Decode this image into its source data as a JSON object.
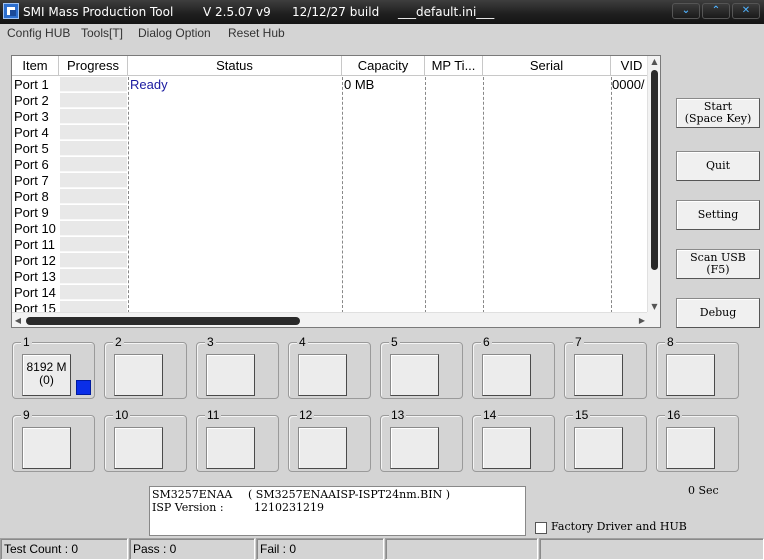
{
  "titlebar": {
    "app_name": "SMI Mass Production Tool",
    "version": "V 2.5.07",
    "v": "v9",
    "build": "12/12/27 build",
    "ini": "___default.ini___",
    "buttons": [
      "chevron-down",
      "chevron-up",
      "close"
    ]
  },
  "menu": [
    "Config HUB",
    "Tools[T]",
    "Dialog Option",
    "Reset Hub"
  ],
  "list": {
    "columns": [
      "Item",
      "Progress",
      "Status",
      "Capacity",
      "MP Ti...",
      "Serial",
      "VID"
    ],
    "rows": [
      {
        "item": "Port 1",
        "status": "Ready",
        "capacity": "0 MB",
        "vid": "0000/"
      },
      {
        "item": "Port 2",
        "status": "",
        "capacity": "",
        "vid": ""
      },
      {
        "item": "Port 3",
        "status": "",
        "capacity": "",
        "vid": ""
      },
      {
        "item": "Port 4",
        "status": "",
        "capacity": "",
        "vid": ""
      },
      {
        "item": "Port 5",
        "status": "",
        "capacity": "",
        "vid": ""
      },
      {
        "item": "Port 6",
        "status": "",
        "capacity": "",
        "vid": ""
      },
      {
        "item": "Port 7",
        "status": "",
        "capacity": "",
        "vid": ""
      },
      {
        "item": "Port 8",
        "status": "",
        "capacity": "",
        "vid": ""
      },
      {
        "item": "Port 9",
        "status": "",
        "capacity": "",
        "vid": ""
      },
      {
        "item": "Port 10",
        "status": "",
        "capacity": "",
        "vid": ""
      },
      {
        "item": "Port 11",
        "status": "",
        "capacity": "",
        "vid": ""
      },
      {
        "item": "Port 12",
        "status": "",
        "capacity": "",
        "vid": ""
      },
      {
        "item": "Port 13",
        "status": "",
        "capacity": "",
        "vid": ""
      },
      {
        "item": "Port 14",
        "status": "",
        "capacity": "",
        "vid": ""
      },
      {
        "item": "Port 15",
        "status": "",
        "capacity": "",
        "vid": ""
      }
    ]
  },
  "side_buttons": {
    "start": "Start\n(Space Key)",
    "quit": "Quit",
    "setting": "Setting",
    "scan_usb": "Scan USB\n(F5)",
    "debug": "Debug"
  },
  "ports": [
    {
      "num": "1",
      "label": "8192 M\n(0)",
      "led_color": "#0a2ee8"
    },
    {
      "num": "2",
      "label": ""
    },
    {
      "num": "3",
      "label": ""
    },
    {
      "num": "4",
      "label": ""
    },
    {
      "num": "5",
      "label": ""
    },
    {
      "num": "6",
      "label": ""
    },
    {
      "num": "7",
      "label": ""
    },
    {
      "num": "8",
      "label": ""
    },
    {
      "num": "9",
      "label": ""
    },
    {
      "num": "10",
      "label": ""
    },
    {
      "num": "11",
      "label": ""
    },
    {
      "num": "12",
      "label": ""
    },
    {
      "num": "13",
      "label": ""
    },
    {
      "num": "14",
      "label": ""
    },
    {
      "num": "15",
      "label": ""
    },
    {
      "num": "16",
      "label": ""
    }
  ],
  "info": {
    "controller": "SM3257ENAA",
    "isp_file": "( SM3257ENAAISP-ISPT24nm.BIN )",
    "isp_label": "ISP Version :",
    "isp_version": "1210231219"
  },
  "timer": "0 Sec",
  "factory_option": {
    "label": "Factory Driver and HUB",
    "checked": false
  },
  "statusbar": {
    "test_count": "Test Count : 0",
    "pass": "Pass : 0",
    "fail": "Fail : 0"
  }
}
